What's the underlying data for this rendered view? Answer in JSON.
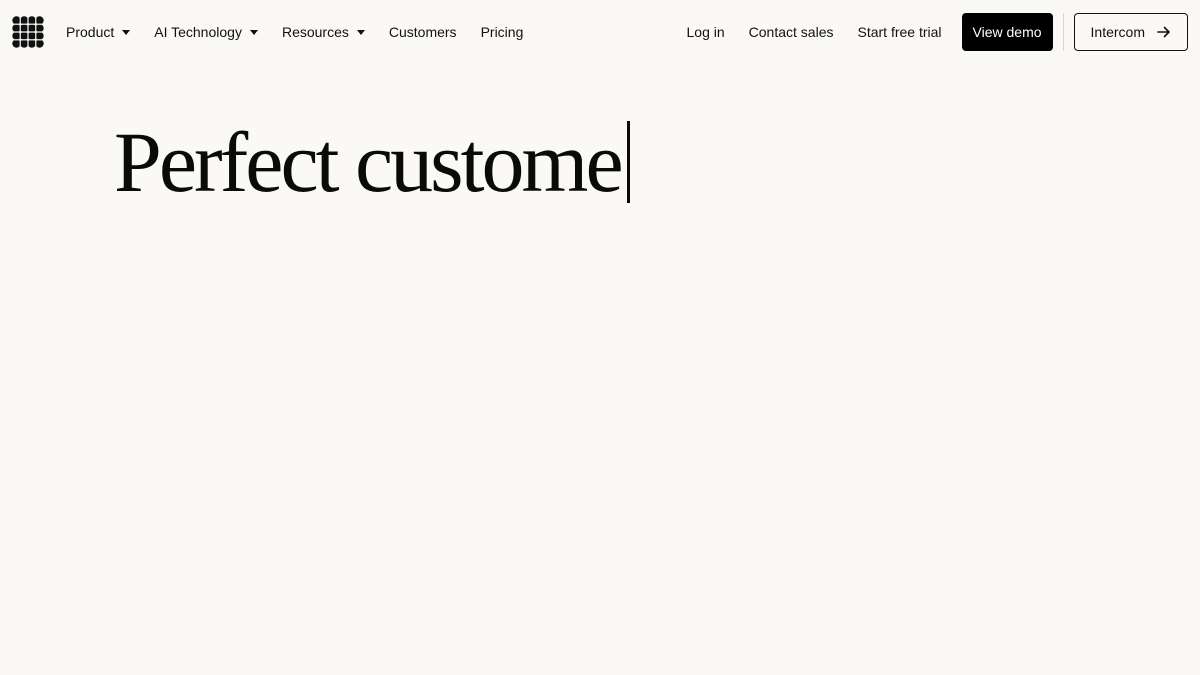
{
  "nav": {
    "logo_icon": "intercom-logo-icon",
    "left_items": [
      {
        "label": "Product",
        "has_dropdown": true
      },
      {
        "label": "AI Technology",
        "has_dropdown": true
      },
      {
        "label": "Resources",
        "has_dropdown": true
      },
      {
        "label": "Customers",
        "has_dropdown": false
      },
      {
        "label": "Pricing",
        "has_dropdown": false
      }
    ],
    "login_label": "Log in",
    "contact_label": "Contact sales",
    "trial_label": "Start free trial",
    "demo_label": "View demo",
    "intercom_label": "Intercom",
    "intercom_icon": "arrow-right-icon"
  },
  "hero": {
    "typed_text": "Perfect custome"
  },
  "colors": {
    "background": "#faf9f6",
    "text": "#111111",
    "button_dark": "#000000"
  }
}
